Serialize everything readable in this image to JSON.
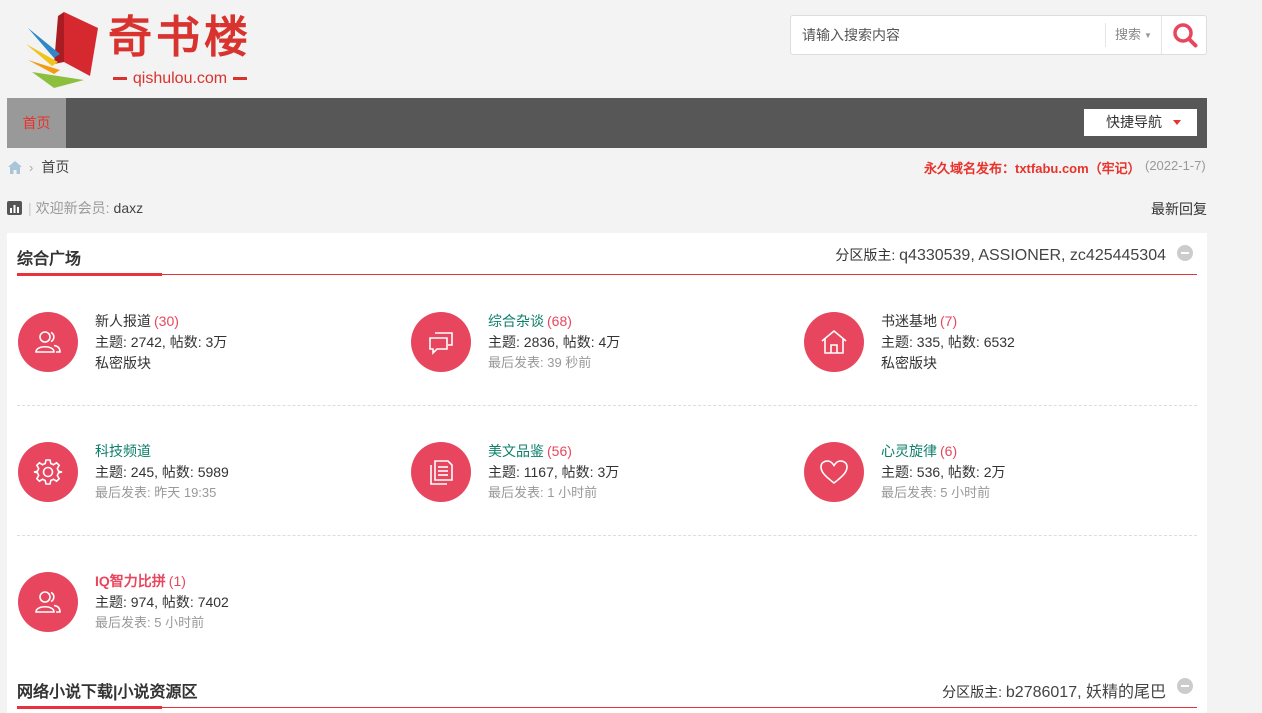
{
  "header": {
    "logo_title": "奇书楼",
    "logo_domain": "qishulou.com",
    "search_placeholder": "请输入搜索内容",
    "search_type": "搜索"
  },
  "nav": {
    "home": "首页",
    "quick_nav": "快捷导航"
  },
  "breadcrumb": {
    "current": "首页"
  },
  "notice": {
    "domain": "永久域名发布：txtfabu.com（牢记）",
    "date": "(2022-1-7)"
  },
  "welcome": {
    "label": "欢迎新会员:",
    "member": "daxz",
    "latest": "最新回复"
  },
  "sections": [
    {
      "title": "综合广场",
      "mods_label": "分区版主:",
      "mods": "q4330539, ASSIONER, zc425445304",
      "forums": [
        {
          "name": "新人报道",
          "count": "(30)",
          "stats": "主题: 2742, 帖数: 3万",
          "last": "私密版块",
          "icon": "users-icon"
        },
        {
          "name": "综合杂谈",
          "count": "(68)",
          "stats": "主题: 2836, 帖数: 4万",
          "last": "最后发表: 39 秒前",
          "icon": "chat-icon"
        },
        {
          "name": "书迷基地",
          "count": "(7)",
          "stats": "主题: 335, 帖数: 6532",
          "last": "私密版块",
          "icon": "home-icon"
        },
        {
          "name": "科技频道",
          "count": "",
          "stats": "主题: 245, 帖数: 5989",
          "last": "最后发表: 昨天 19:35",
          "icon": "gear-icon"
        },
        {
          "name": "美文品鉴",
          "count": "(56)",
          "stats": "主题: 1167, 帖数: 3万",
          "last": "最后发表: 1 小时前",
          "icon": "document-icon"
        },
        {
          "name": "心灵旋律",
          "count": "(6)",
          "stats": "主题: 536, 帖数: 2万",
          "last": "最后发表: 5 小时前",
          "icon": "heart-icon"
        },
        {
          "name": "IQ智力比拼",
          "count": "(1)",
          "stats": "主题: 974, 帖数: 7402",
          "last": "最后发表: 5 小时前",
          "icon": "users-icon"
        }
      ]
    },
    {
      "title": "网络小说下载|小说资源区",
      "mods_label": "分区版主:",
      "mods": "b2786017, 妖精的尾巴"
    }
  ],
  "colors": {
    "accent": "#e8465e",
    "nav_bg": "#575757",
    "notice_red": "#e8322b",
    "forum_green": "#0b7f6a"
  }
}
